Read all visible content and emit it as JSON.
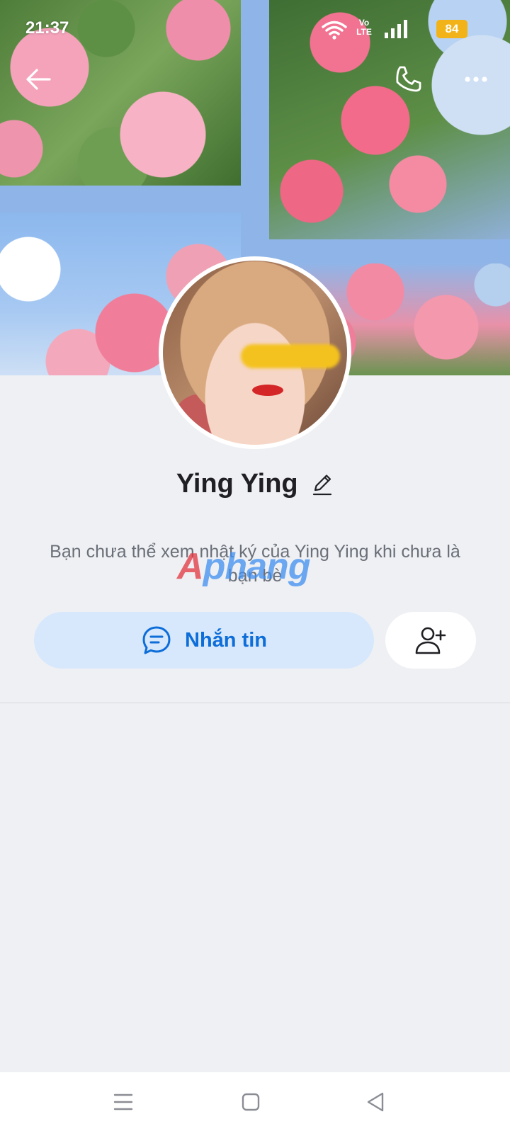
{
  "status_bar": {
    "time": "21:37",
    "network_label_top": "Vo",
    "network_label_bottom": "LTE",
    "battery": "84"
  },
  "toolbar": {
    "back_icon": "arrow-left-icon",
    "call_icon": "phone-icon",
    "more_icon": "more-horizontal-icon"
  },
  "profile": {
    "name": "Ying Ying",
    "notice": "Bạn chưa thể xem nhật ký của Ying Ying khi chưa là bạn bè"
  },
  "actions": {
    "message_label": "Nhắn tin",
    "message_icon": "chat-bubble-icon",
    "add_friend_icon": "add-user-icon"
  },
  "watermark": {
    "first": "A",
    "rest": "phang"
  },
  "colors": {
    "accent": "#0d6dd9",
    "message_button_bg": "#d7e8fc",
    "page_bg": "#eff0f4",
    "battery": "#f2b318"
  }
}
